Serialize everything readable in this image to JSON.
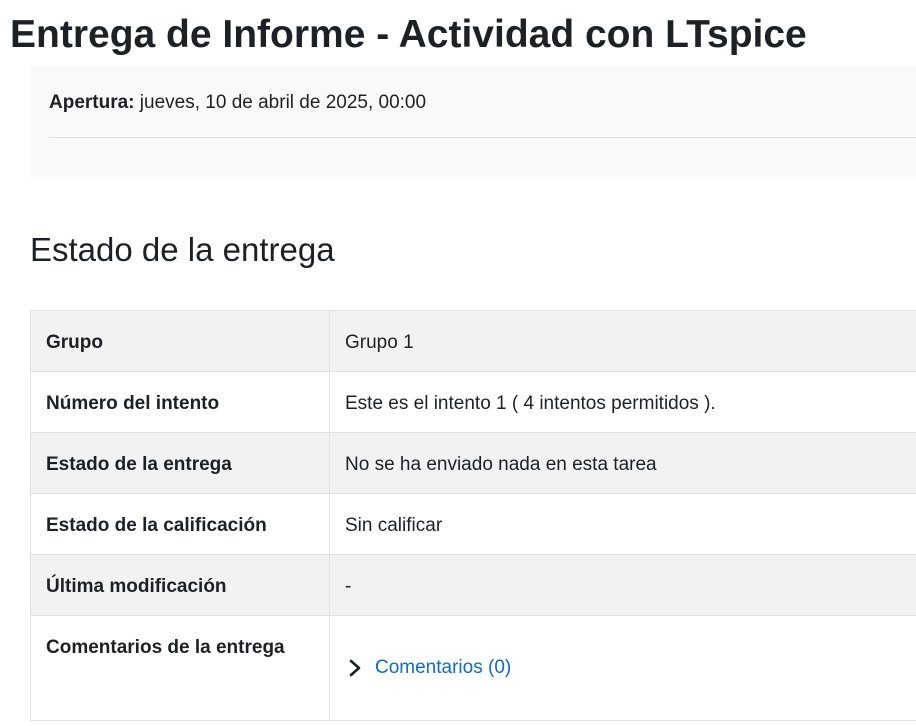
{
  "page": {
    "title": "Entrega de Informe - Actividad con LTspice"
  },
  "dates": {
    "open_label": "Apertura:",
    "open_value": "jueves, 10 de abril de 2025, 00:00"
  },
  "submission_status": {
    "heading": "Estado de la entrega",
    "rows": [
      {
        "label": "Grupo",
        "value": "Grupo 1"
      },
      {
        "label": "Número del intento",
        "value": "Este es el intento 1 ( 4 intentos permitidos )."
      },
      {
        "label": "Estado de la entrega",
        "value": "No se ha enviado nada en esta tarea"
      },
      {
        "label": "Estado de la calificación",
        "value": "Sin calificar"
      },
      {
        "label": "Última modificación",
        "value": "-"
      },
      {
        "label": "Comentarios de la entrega",
        "link": "Comentarios (0)",
        "icon": "chevron-right-icon"
      }
    ]
  },
  "colors": {
    "link": "#0f6cbf",
    "row_shaded": "#f2f2f2",
    "border": "#dee2e6",
    "dates_bg": "#f8f9fa"
  }
}
